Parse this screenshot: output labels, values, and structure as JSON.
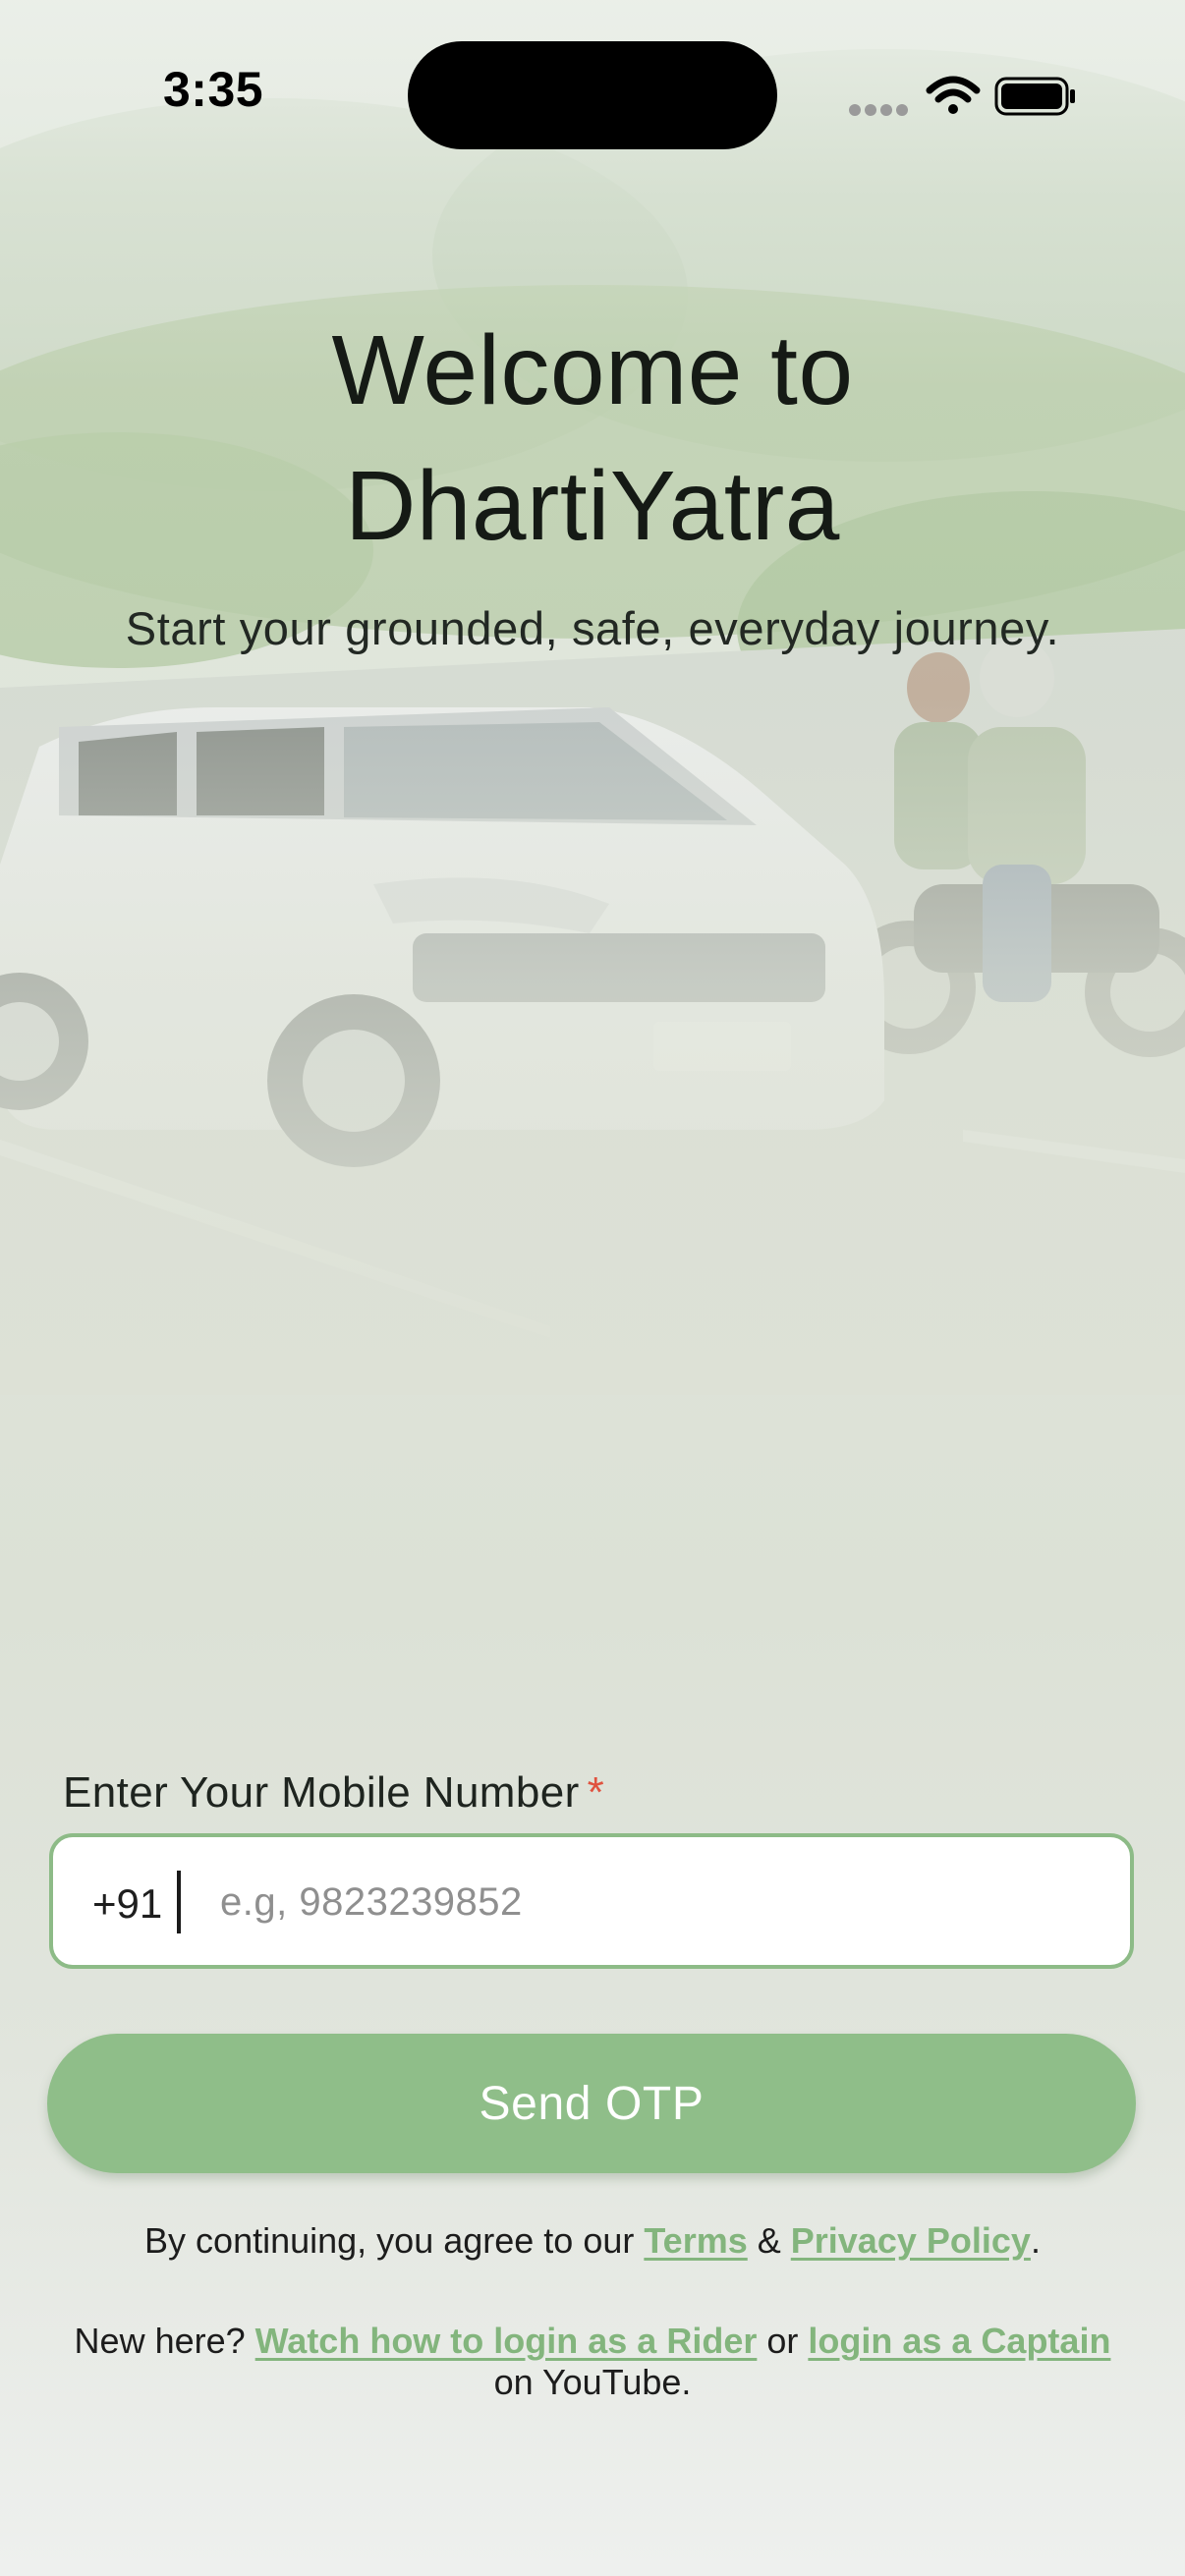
{
  "status_bar": {
    "time": "3:35",
    "icons": [
      "cellular-icon",
      "wifi-icon",
      "battery-icon"
    ]
  },
  "header": {
    "title_line1": "Welcome to",
    "title_line2": "DhartiYatra",
    "subtitle": "Start your grounded, safe, everyday journey."
  },
  "background": {
    "image": "hero-photo-suv-and-motorcycle-riders-on-road"
  },
  "form": {
    "label": "Enter Your Mobile Number",
    "required_mark": "*",
    "country_code": "+91",
    "phone_value": "",
    "phone_placeholder": "e.g, 9823239852",
    "send_button": "Send OTP"
  },
  "legal": {
    "prefix": "By continuing, you agree to our ",
    "terms_link": "Terms",
    "and": " & ",
    "privacy_link": "Privacy Policy",
    "suffix": "."
  },
  "help": {
    "prefix": "New here? ",
    "rider_link": "Watch how to login as a Rider",
    "or": " or ",
    "captain_link": "login as a Captain",
    "suffix": "on YouTube."
  },
  "colors": {
    "accent": "#8fbe89",
    "link": "#83b57d",
    "required": "#e0523f",
    "field_border": "#8dbb87"
  }
}
